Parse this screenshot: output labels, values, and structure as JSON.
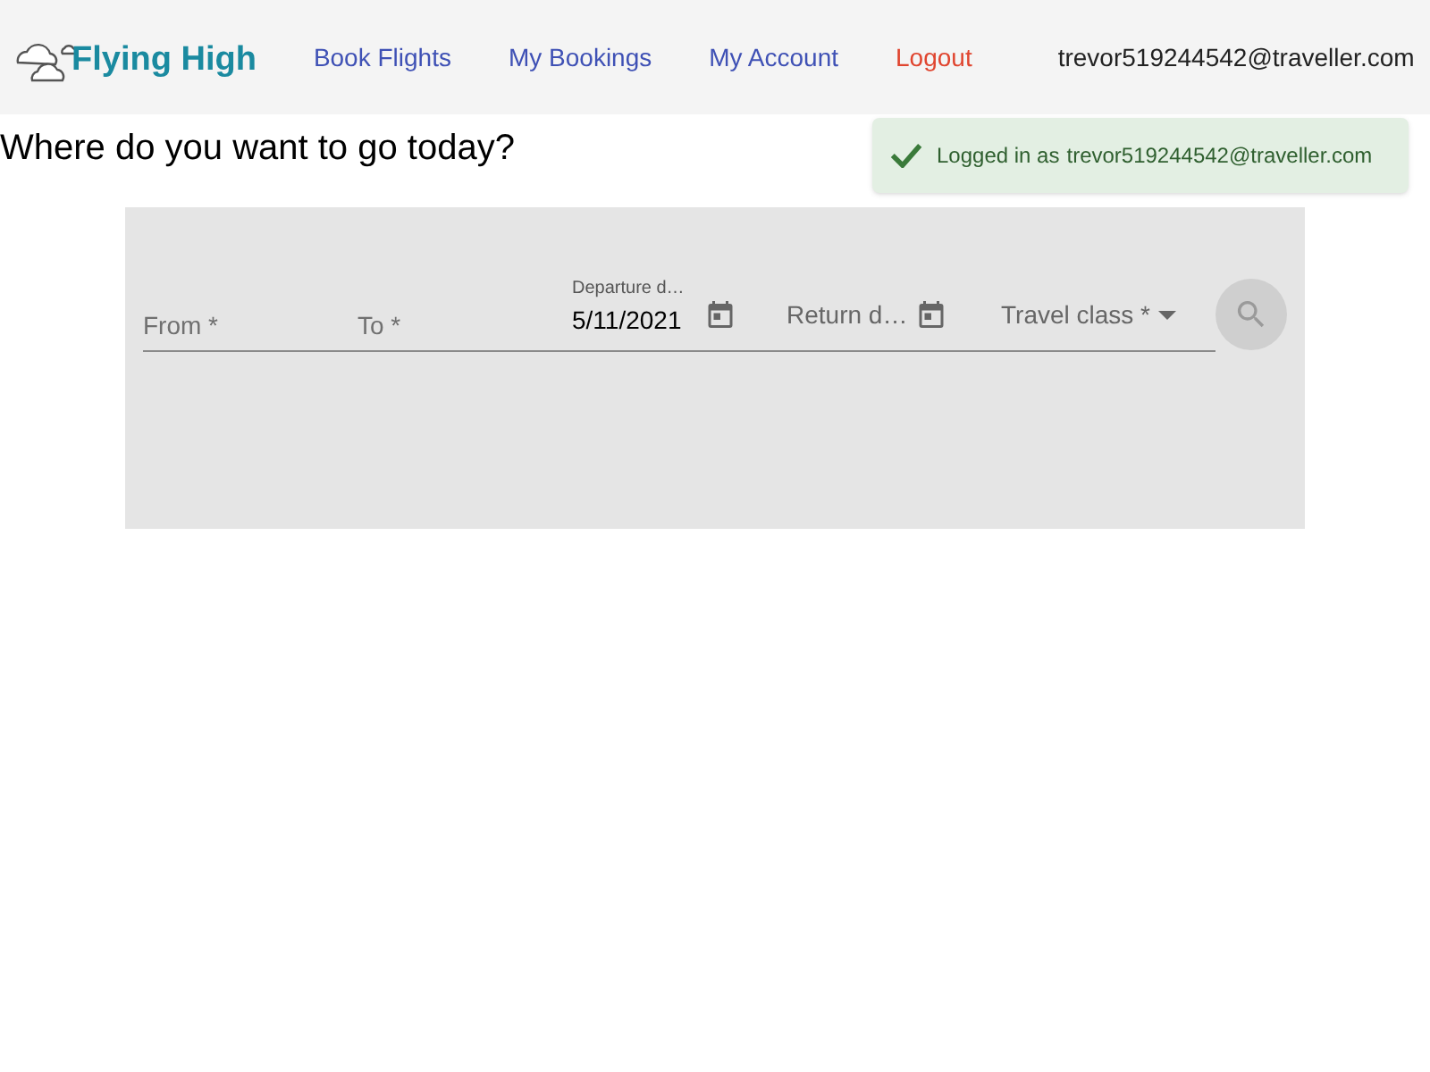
{
  "header": {
    "logo": "Flying High",
    "nav": [
      {
        "label": "Book Flights",
        "kind": "link"
      },
      {
        "label": "My Bookings",
        "kind": "link"
      },
      {
        "label": "My Account",
        "kind": "link"
      },
      {
        "label": "Logout",
        "kind": "logout"
      }
    ],
    "user_email": "trevor519244542@traveller.com"
  },
  "toast": {
    "line_1": "Logged in as",
    "line_2": "trevor519244542@traveller.com"
  },
  "heading": "Where do you want to go today?",
  "search_form": {
    "from": {
      "placeholder": "From *"
    },
    "to": {
      "placeholder": "To *"
    },
    "departure_date": {
      "label": "Departure d…",
      "value": "5/11/2021"
    },
    "return_date": {
      "placeholder": "Return d…"
    },
    "travel_class": {
      "placeholder": "Travel class *"
    },
    "search_button": {
      "disabled": true
    }
  }
}
